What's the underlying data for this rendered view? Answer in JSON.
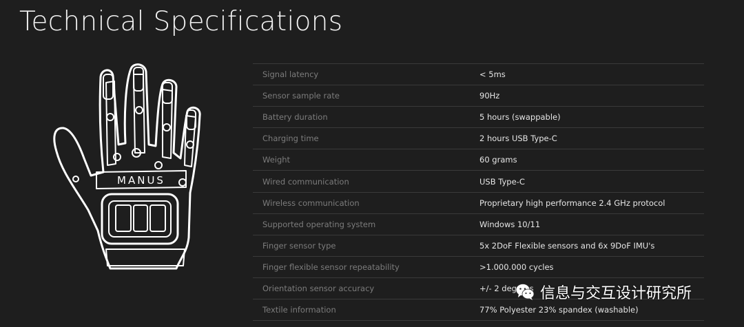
{
  "page": {
    "title": "Technical Specifications"
  },
  "glove": {
    "logo_text": "MANUS",
    "stroke_color": "#ffffff"
  },
  "specs": [
    {
      "label": "Signal latency",
      "value": "< 5ms"
    },
    {
      "label": "Sensor sample rate",
      "value": "90Hz"
    },
    {
      "label": "Battery duration",
      "value": "5 hours (swappable)"
    },
    {
      "label": "Charging time",
      "value": "2 hours USB Type-C"
    },
    {
      "label": "Weight",
      "value": "60 grams"
    },
    {
      "label": "Wired communication",
      "value": "USB Type-C"
    },
    {
      "label": "Wireless communication",
      "value": "Proprietary high performance 2.4 GHz protocol"
    },
    {
      "label": "Supported operating system",
      "value": "Windows 10/11"
    },
    {
      "label": "Finger sensor type",
      "value": "5x 2DoF Flexible sensors and 6x 9DoF IMU's"
    },
    {
      "label": "Finger flexible sensor repeatability",
      "value": ">1.000.000 cycles"
    },
    {
      "label": "Orientation sensor accuracy",
      "value": "+/- 2 degrees"
    },
    {
      "label": "Textile information",
      "value": "77% Polyester 23% spandex (washable)"
    }
  ],
  "watermark": {
    "icon": "wechat-icon",
    "text": "信息与交互设计研究所"
  },
  "colors": {
    "background": "#1e1e1e",
    "label": "#7c7c7c",
    "value": "#e6e6e6",
    "divider": "#3a3a3a"
  }
}
